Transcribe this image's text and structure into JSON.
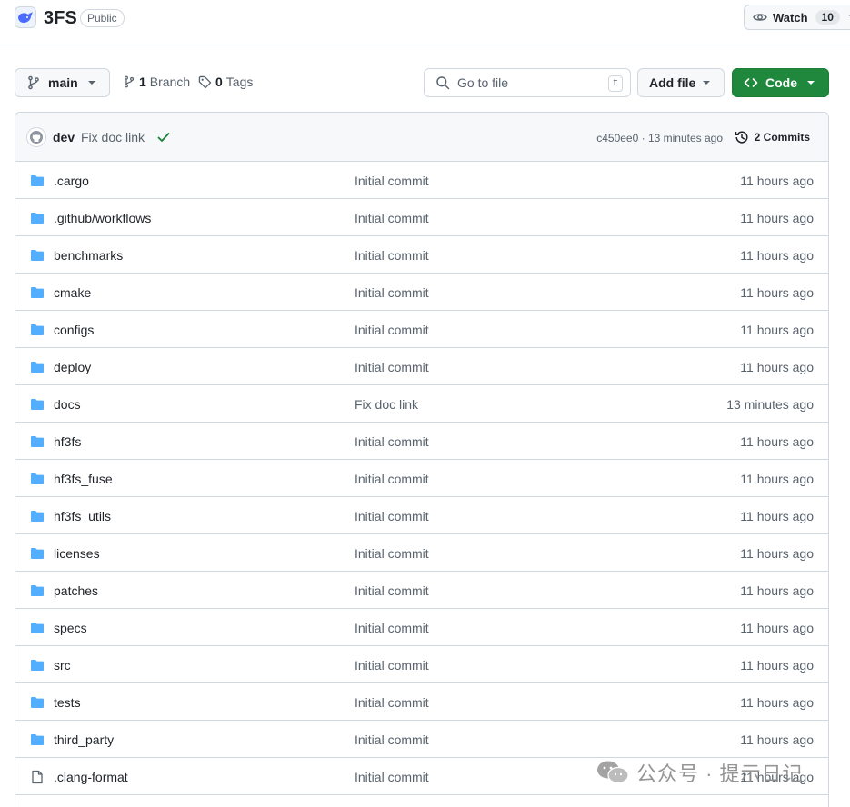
{
  "repo": {
    "name": "3FS",
    "visibility": "Public",
    "watch_label": "Watch",
    "watch_count": "10"
  },
  "toolbar": {
    "branch": "main",
    "branches_count": "1",
    "branches_unit": "Branch",
    "tags_count": "0",
    "tags_unit": "Tags",
    "search_placeholder": "Go to file",
    "search_shortcut": "t",
    "add_file_label": "Add file",
    "code_label": "Code"
  },
  "latest_commit": {
    "author": "dev",
    "message": "Fix doc link",
    "hash_time": "c450ee0 · 13 minutes ago",
    "commits_label": "2 Commits"
  },
  "files": [
    {
      "name": ".cargo",
      "type": "dir",
      "message": "Initial commit",
      "time": "11 hours ago"
    },
    {
      "name": ".github/workflows",
      "type": "dir",
      "message": "Initial commit",
      "time": "11 hours ago"
    },
    {
      "name": "benchmarks",
      "type": "dir",
      "message": "Initial commit",
      "time": "11 hours ago"
    },
    {
      "name": "cmake",
      "type": "dir",
      "message": "Initial commit",
      "time": "11 hours ago"
    },
    {
      "name": "configs",
      "type": "dir",
      "message": "Initial commit",
      "time": "11 hours ago"
    },
    {
      "name": "deploy",
      "type": "dir",
      "message": "Initial commit",
      "time": "11 hours ago"
    },
    {
      "name": "docs",
      "type": "dir",
      "message": "Fix doc link",
      "time": "13 minutes ago"
    },
    {
      "name": "hf3fs",
      "type": "dir",
      "message": "Initial commit",
      "time": "11 hours ago"
    },
    {
      "name": "hf3fs_fuse",
      "type": "dir",
      "message": "Initial commit",
      "time": "11 hours ago"
    },
    {
      "name": "hf3fs_utils",
      "type": "dir",
      "message": "Initial commit",
      "time": "11 hours ago"
    },
    {
      "name": "licenses",
      "type": "dir",
      "message": "Initial commit",
      "time": "11 hours ago"
    },
    {
      "name": "patches",
      "type": "dir",
      "message": "Initial commit",
      "time": "11 hours ago"
    },
    {
      "name": "specs",
      "type": "dir",
      "message": "Initial commit",
      "time": "11 hours ago"
    },
    {
      "name": "src",
      "type": "dir",
      "message": "Initial commit",
      "time": "11 hours ago"
    },
    {
      "name": "tests",
      "type": "dir",
      "message": "Initial commit",
      "time": "11 hours ago"
    },
    {
      "name": "third_party",
      "type": "dir",
      "message": "Initial commit",
      "time": "11 hours ago"
    },
    {
      "name": ".clang-format",
      "type": "file",
      "message": "Initial commit",
      "time": "11 hours ago"
    }
  ],
  "watermark": {
    "text": "公众号 · 提示日记"
  },
  "colors": {
    "folder": "#54aeff",
    "code_button": "#1f883d",
    "check": "#1a7f37",
    "muted": "#59636e",
    "border": "#d0d7de"
  }
}
